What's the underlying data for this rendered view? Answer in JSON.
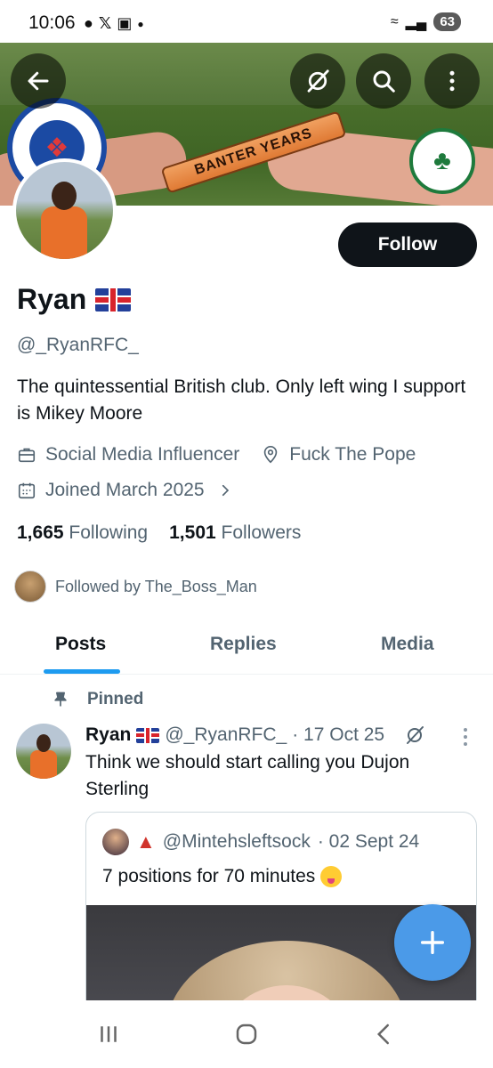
{
  "status_bar": {
    "time": "10:06",
    "battery": "63"
  },
  "banner": {
    "baton_text": "BANTER YEARS"
  },
  "profile": {
    "name": "Ryan",
    "handle": "@_RyanRFC_",
    "bio": "The quintessential British club. Only left wing I support is Mikey Moore",
    "job": "Social Media Influencer",
    "location": "Fuck The Pope",
    "joined": "Joined March 2025",
    "following_count": "1,665",
    "following_label": "Following",
    "followers_count": "1,501",
    "followers_label": "Followers",
    "followed_by": "Followed by The_Boss_Man"
  },
  "actions": {
    "follow_label": "Follow"
  },
  "tabs": [
    {
      "label": "Posts",
      "active": true
    },
    {
      "label": "Replies",
      "active": false
    },
    {
      "label": "Media",
      "active": false
    }
  ],
  "pinned_post": {
    "pinned_label": "Pinned",
    "author_name": "Ryan",
    "author_handle": "@_RyanRFC_",
    "date": "· 17 Oct 25",
    "text": "Think we should start calling you Dujon Sterling",
    "quote": {
      "handle": "@Mintehsleftsock",
      "date": "· 02 Sept 24",
      "text": "7 positions for 70 minutes"
    }
  },
  "colors": {
    "accent": "#1d9bf0",
    "follow_bg": "#0f1419",
    "fab": "#4b9ae8",
    "muted": "#536471"
  },
  "icons": [
    "back-arrow-icon",
    "grok-icon",
    "search-icon",
    "more-vertical-icon",
    "briefcase-icon",
    "location-pin-icon",
    "calendar-icon",
    "chevron-right-icon",
    "pin-icon",
    "plus-icon",
    "recents-icon",
    "home-icon",
    "back-icon"
  ]
}
